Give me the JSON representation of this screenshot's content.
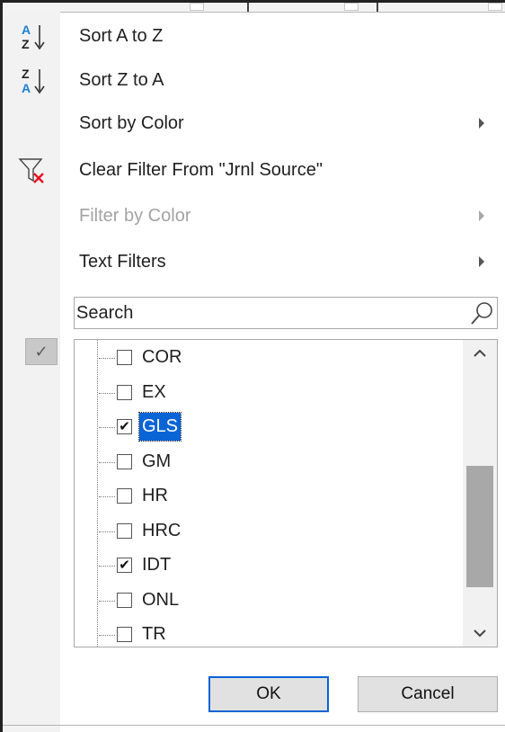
{
  "menu": {
    "sort_a_to_z": "Sort A to Z",
    "sort_z_to_a": "Sort Z to A",
    "sort_by_color": "Sort by Color",
    "clear_filter": "Clear Filter From \"Jrnl Source\"",
    "filter_by_color": "Filter by Color",
    "text_filters": "Text Filters"
  },
  "search": {
    "placeholder": "Search"
  },
  "list": {
    "items": [
      {
        "label": "COR",
        "checked": false
      },
      {
        "label": "EX",
        "checked": false
      },
      {
        "label": "GLS",
        "checked": true,
        "selected": true
      },
      {
        "label": "GM",
        "checked": false
      },
      {
        "label": "HR",
        "checked": false
      },
      {
        "label": "HRC",
        "checked": false
      },
      {
        "label": "IDT",
        "checked": true
      },
      {
        "label": "ONL",
        "checked": false
      },
      {
        "label": "TR",
        "checked": false
      }
    ]
  },
  "icons": {
    "sort_asc": "sort-ascending-icon",
    "sort_desc": "sort-descending-icon",
    "clear_filter": "clear-filter-icon",
    "search": "magnifier-icon",
    "checkmark": "checkmark-icon"
  },
  "colors": {
    "accent": "#0a64d6",
    "clear_x": "#e81123"
  },
  "buttons": {
    "ok": "OK",
    "cancel": "Cancel"
  }
}
